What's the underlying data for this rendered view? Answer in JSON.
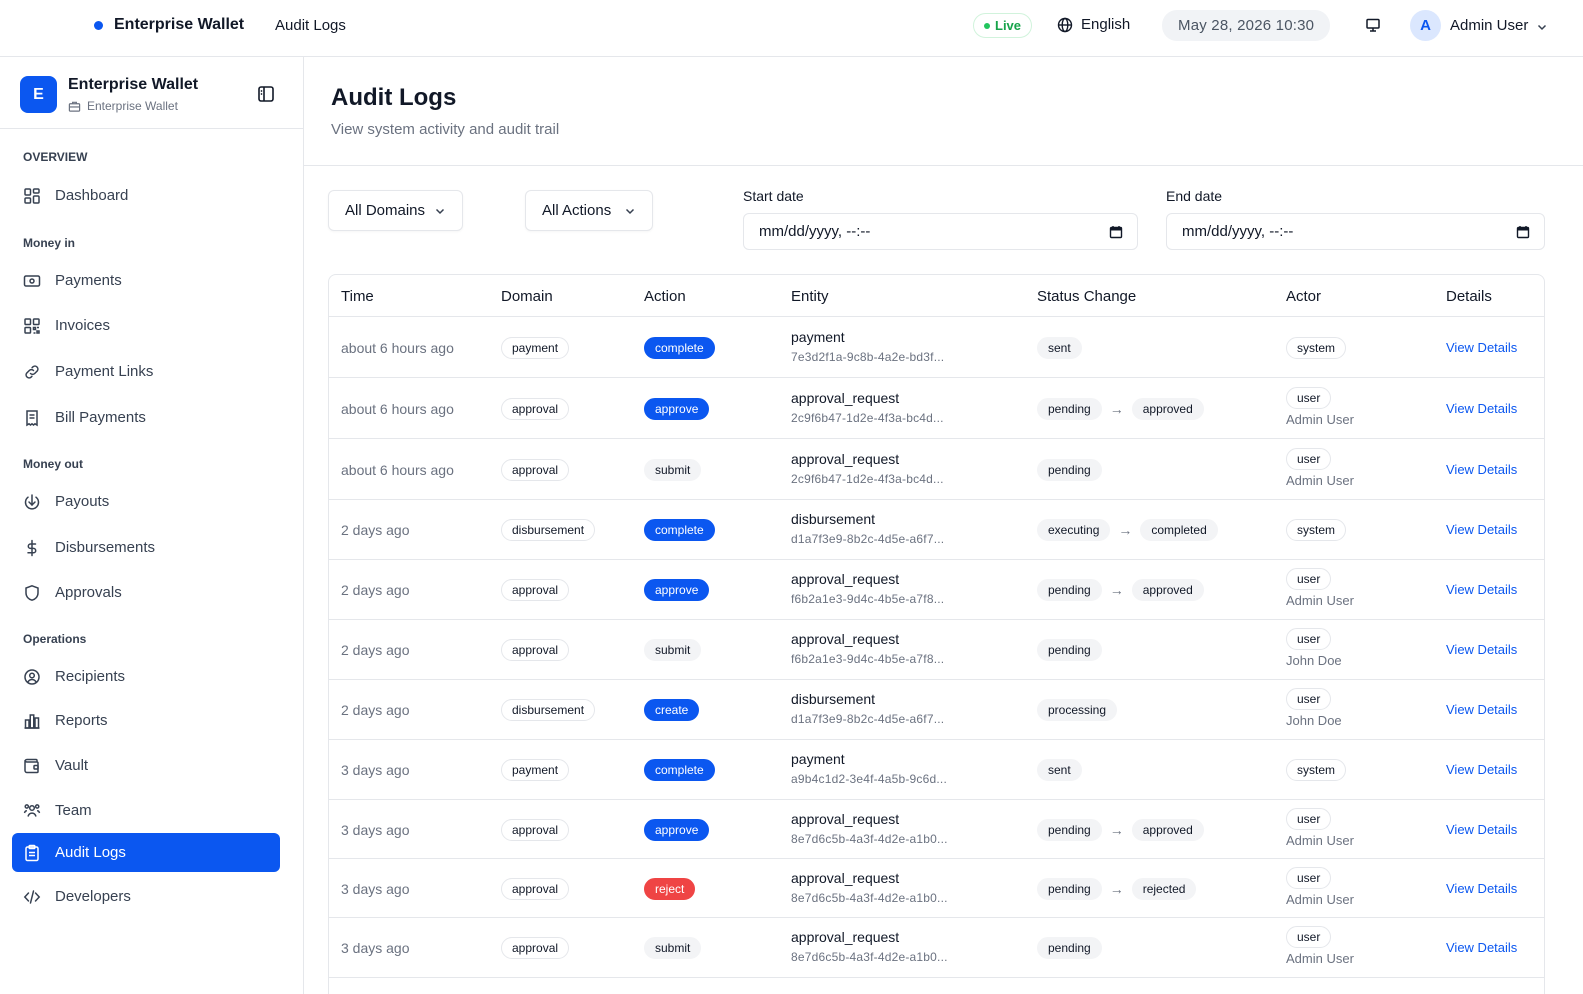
{
  "topbar": {
    "brand": "Enterprise Wallet",
    "breadcrumb": "Audit Logs",
    "live": "Live",
    "language": "English",
    "datetime": "May 28, 2026 10:30",
    "avatar_letter": "A",
    "user_name": "Admin User"
  },
  "sidebar": {
    "logo_letter": "E",
    "title": "Enterprise Wallet",
    "subtitle": "Enterprise Wallet",
    "sections": {
      "overview": "OVERVIEW",
      "money_in": "Money in",
      "money_out": "Money out",
      "operations": "Operations"
    },
    "items": [
      {
        "label": "Dashboard",
        "icon": "grid-icon"
      },
      {
        "label": "Payments",
        "icon": "cash-icon"
      },
      {
        "label": "Invoices",
        "icon": "qr-grid-icon"
      },
      {
        "label": "Payment Links",
        "icon": "link-icon"
      },
      {
        "label": "Bill Payments",
        "icon": "receipt-icon"
      },
      {
        "label": "Payouts",
        "icon": "download-circle-icon"
      },
      {
        "label": "Disbursements",
        "icon": "dollar-icon"
      },
      {
        "label": "Approvals",
        "icon": "shield-icon"
      },
      {
        "label": "Recipients",
        "icon": "user-circle-icon"
      },
      {
        "label": "Reports",
        "icon": "bar-chart-icon"
      },
      {
        "label": "Vault",
        "icon": "wallet-icon"
      },
      {
        "label": "Team",
        "icon": "users-icon"
      },
      {
        "label": "Audit Logs",
        "icon": "clipboard-icon",
        "active": true
      },
      {
        "label": "Developers",
        "icon": "code-icon"
      }
    ]
  },
  "page": {
    "title": "Audit Logs",
    "subtitle": "View system activity and audit trail"
  },
  "filters": {
    "domain_selected": "All Domains",
    "action_selected": "All Actions",
    "start_label": "Start date",
    "start_placeholder": "mm/dd/yyyy, --:--",
    "end_label": "End date",
    "end_placeholder": "mm/dd/yyyy, --:--"
  },
  "table": {
    "columns": [
      "Time",
      "Domain",
      "Action",
      "Entity",
      "Status Change",
      "Actor",
      "Details"
    ],
    "details_label": "View Details",
    "rows": [
      {
        "time": "about 6 hours ago",
        "domain": "payment",
        "action": "complete",
        "action_style": "blue",
        "entity_type": "payment",
        "entity_id": "7e3d2f1a-9c8b-4a2e-bd3f...",
        "status_from": "sent",
        "status_to": "",
        "actor": "system",
        "actor_name": ""
      },
      {
        "time": "about 6 hours ago",
        "domain": "approval",
        "action": "approve",
        "action_style": "blue",
        "entity_type": "approval_request",
        "entity_id": "2c9f6b47-1d2e-4f3a-bc4d...",
        "status_from": "pending",
        "status_to": "approved",
        "actor": "user",
        "actor_name": "Admin User"
      },
      {
        "time": "about 6 hours ago",
        "domain": "approval",
        "action": "submit",
        "action_style": "gray",
        "entity_type": "approval_request",
        "entity_id": "2c9f6b47-1d2e-4f3a-bc4d...",
        "status_from": "pending",
        "status_to": "",
        "actor": "user",
        "actor_name": "Admin User"
      },
      {
        "time": "2 days ago",
        "domain": "disbursement",
        "action": "complete",
        "action_style": "blue",
        "entity_type": "disbursement",
        "entity_id": "d1a7f3e9-8b2c-4d5e-a6f7...",
        "status_from": "executing",
        "status_to": "completed",
        "actor": "system",
        "actor_name": ""
      },
      {
        "time": "2 days ago",
        "domain": "approval",
        "action": "approve",
        "action_style": "blue",
        "entity_type": "approval_request",
        "entity_id": "f6b2a1e3-9d4c-4b5e-a7f8...",
        "status_from": "pending",
        "status_to": "approved",
        "actor": "user",
        "actor_name": "Admin User"
      },
      {
        "time": "2 days ago",
        "domain": "approval",
        "action": "submit",
        "action_style": "gray",
        "entity_type": "approval_request",
        "entity_id": "f6b2a1e3-9d4c-4b5e-a7f8...",
        "status_from": "pending",
        "status_to": "",
        "actor": "user",
        "actor_name": "John Doe"
      },
      {
        "time": "2 days ago",
        "domain": "disbursement",
        "action": "create",
        "action_style": "blue",
        "entity_type": "disbursement",
        "entity_id": "d1a7f3e9-8b2c-4d5e-a6f7...",
        "status_from": "processing",
        "status_to": "",
        "actor": "user",
        "actor_name": "John Doe"
      },
      {
        "time": "3 days ago",
        "domain": "payment",
        "action": "complete",
        "action_style": "blue",
        "entity_type": "payment",
        "entity_id": "a9b4c1d2-3e4f-4a5b-9c6d...",
        "status_from": "sent",
        "status_to": "",
        "actor": "system",
        "actor_name": ""
      },
      {
        "time": "3 days ago",
        "domain": "approval",
        "action": "approve",
        "action_style": "blue",
        "entity_type": "approval_request",
        "entity_id": "8e7d6c5b-4a3f-4d2e-a1b0...",
        "status_from": "pending",
        "status_to": "approved",
        "actor": "user",
        "actor_name": "Admin User"
      },
      {
        "time": "3 days ago",
        "domain": "approval",
        "action": "reject",
        "action_style": "red",
        "entity_type": "approval_request",
        "entity_id": "8e7d6c5b-4a3f-4d2e-a1b0...",
        "status_from": "pending",
        "status_to": "rejected",
        "actor": "user",
        "actor_name": "Admin User"
      },
      {
        "time": "3 days ago",
        "domain": "approval",
        "action": "submit",
        "action_style": "gray",
        "entity_type": "approval_request",
        "entity_id": "8e7d6c5b-4a3f-4d2e-a1b0...",
        "status_from": "pending",
        "status_to": "",
        "actor": "user",
        "actor_name": "Admin User"
      }
    ]
  },
  "colors": {
    "accent": "#0b57f0",
    "reject": "#ef4444",
    "live": "#16a34a"
  }
}
